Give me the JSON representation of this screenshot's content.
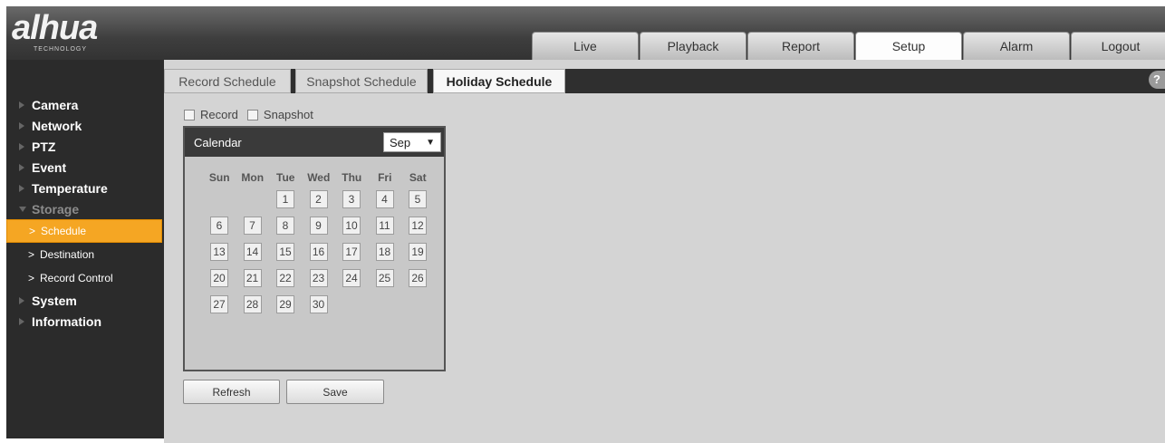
{
  "logo": {
    "brand": "alhua",
    "sub": "TECHNOLOGY"
  },
  "nav": [
    "Live",
    "Playback",
    "Report",
    "Setup",
    "Alarm",
    "Logout"
  ],
  "sidebar": {
    "items": [
      "Camera",
      "Network",
      "PTZ",
      "Event",
      "Temperature",
      "Storage"
    ],
    "sub_items": [
      "Schedule",
      "Destination",
      "Record Control"
    ],
    "items_after": [
      "System",
      "Information"
    ]
  },
  "tabs": [
    "Record Schedule",
    "Snapshot Schedule",
    "Holiday Schedule"
  ],
  "help_icon": "?",
  "options": {
    "record": "Record",
    "snapshot": "Snapshot"
  },
  "calendar": {
    "title": "Calendar",
    "month": "Sep",
    "dow": [
      "Sun",
      "Mon",
      "Tue",
      "Wed",
      "Thu",
      "Fri",
      "Sat"
    ],
    "days": [
      "1",
      "2",
      "3",
      "4",
      "5",
      "6",
      "7",
      "8",
      "9",
      "10",
      "11",
      "12",
      "13",
      "14",
      "15",
      "16",
      "17",
      "18",
      "19",
      "20",
      "21",
      "22",
      "23",
      "24",
      "25",
      "26",
      "27",
      "28",
      "29",
      "30"
    ]
  },
  "buttons": {
    "refresh": "Refresh",
    "save": "Save"
  }
}
